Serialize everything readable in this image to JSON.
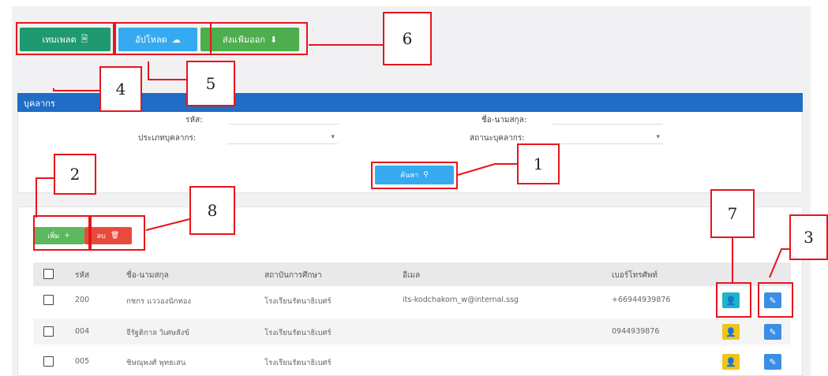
{
  "toolbar": {
    "template_label": "เทมเพลต",
    "upload_label": "อัปโหลด",
    "export_label": "ส่งแฟ้มออก"
  },
  "panel": {
    "title": "บุคลากร",
    "fields": {
      "code_label": "รหัส:",
      "fullname_label": "ชื่อ-นามสกุล:",
      "type_label": "ประเภทบุคลากร:",
      "status_label": "สถานะบุคลากร:"
    },
    "search_label": "ค้นหา"
  },
  "list": {
    "add_label": "เพิ่ม",
    "delete_label": "ลบ",
    "columns": [
      "รหัส",
      "ชื่อ-นามสกุล",
      "สถาบันการศึกษา",
      "อีเมล",
      "เบอร์โทรศัพท์"
    ],
    "rows": [
      {
        "code": "200",
        "name": "กชกร แววองนักทอง",
        "school": "โรงเรียนรัตนาธิเบศร์",
        "email": "its-kodchakorn_w@internal.ssg",
        "phone": "+66944939876"
      },
      {
        "code": "004",
        "name": "จีรัฐติกาล วิเศษสังข์",
        "school": "โรงเรียนรัตนาธิเบศร์",
        "email": "",
        "phone": "0944939876"
      },
      {
        "code": "005",
        "name": "ชิษณุพงศ์ พุทธเสน",
        "school": "โรงเรียนรัตนาธิเบศร์",
        "email": "",
        "phone": ""
      }
    ]
  },
  "annotations": {
    "n1": "1",
    "n2": "2",
    "n3": "3",
    "n4": "4",
    "n5": "5",
    "n6": "6",
    "n7": "7",
    "n8": "8"
  },
  "colors": {
    "annotation": "#e8141c",
    "header": "#1f6dc4",
    "template": "#1e9970",
    "upload": "#36aaf0",
    "export": "#4cae4c",
    "add": "#5cb85c",
    "delete": "#e84b3c"
  }
}
